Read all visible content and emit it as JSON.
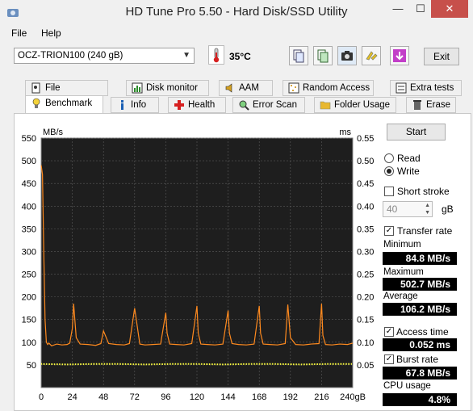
{
  "window": {
    "title": "HD Tune Pro 5.50 - Hard Disk/SSD Utility",
    "minimize": "—",
    "maximize": "☐",
    "close": "✕"
  },
  "menu": [
    {
      "label": "File"
    },
    {
      "label": "Help"
    }
  ],
  "toolbar": {
    "drive": "OCZ-TRION100 (240 gB)",
    "temperature": "35°C",
    "exit_label": "Exit",
    "buttons": [
      "copy-text-icon",
      "copy-info-icon",
      "screenshot-icon",
      "options-icon",
      "save-icon"
    ]
  },
  "tabs_row1": [
    {
      "label": "File Benchmark",
      "icon": "file-benchmark-icon"
    },
    {
      "label": "Disk monitor",
      "icon": "disk-monitor-icon"
    },
    {
      "label": "AAM",
      "icon": "speaker-icon"
    },
    {
      "label": "Random Access",
      "icon": "random-access-icon"
    },
    {
      "label": "Extra tests",
      "icon": "extra-tests-icon"
    }
  ],
  "tabs_row2": [
    {
      "label": "Benchmark",
      "icon": "benchmark-icon",
      "active": true
    },
    {
      "label": "Info",
      "icon": "info-icon"
    },
    {
      "label": "Health",
      "icon": "health-icon"
    },
    {
      "label": "Error Scan",
      "icon": "error-scan-icon"
    },
    {
      "label": "Folder Usage",
      "icon": "folder-icon"
    },
    {
      "label": "Erase",
      "icon": "trash-icon"
    }
  ],
  "controls": {
    "start_label": "Start",
    "read_label": "Read",
    "write_label": "Write",
    "mode": "write",
    "short_stroke_label": "Short stroke",
    "short_stroke_checked": false,
    "short_stroke_value": "40",
    "short_stroke_unit": "gB",
    "transfer_rate_label": "Transfer rate",
    "transfer_rate_checked": true,
    "minimum_label": "Minimum",
    "minimum_value": "84.8 MB/s",
    "maximum_label": "Maximum",
    "maximum_value": "502.7 MB/s",
    "average_label": "Average",
    "average_value": "106.2 MB/s",
    "access_time_label": "Access time",
    "access_time_checked": true,
    "access_time_value": "0.052 ms",
    "burst_rate_label": "Burst rate",
    "burst_rate_checked": true,
    "burst_rate_value": "67.8 MB/s",
    "cpu_usage_label": "CPU usage",
    "cpu_usage_value": "4.8%"
  },
  "colors": {
    "chart_bg": "#1e1e1e",
    "grid": "#5a5a5a",
    "transfer": "#ff8a1e",
    "access": "#ffff40",
    "stat_bg": "#000000",
    "stat_fg": "#ffffff"
  },
  "chart_data": {
    "type": "line",
    "y_left_label": "MB/s",
    "y_right_label": "ms",
    "y_left_ticks": [
      "550",
      "500",
      "450",
      "400",
      "350",
      "300",
      "250",
      "200",
      "150",
      "100",
      "50"
    ],
    "y_right_ticks": [
      "0.55",
      "0.50",
      "0.45",
      "0.40",
      "0.35",
      "0.30",
      "0.25",
      "0.20",
      "0.15",
      "0.10",
      "0.05"
    ],
    "x_ticks": [
      "0",
      "24",
      "48",
      "72",
      "96",
      "120",
      "144",
      "168",
      "192",
      "216",
      "240gB"
    ],
    "ylim_left": [
      0,
      550
    ],
    "ylim_right": [
      0,
      0.55
    ],
    "xlim": [
      0,
      240
    ],
    "grid": true,
    "series": [
      {
        "name": "Transfer rate",
        "axis": "left",
        "x": [
          0,
          1,
          2,
          3,
          4,
          5,
          6,
          8,
          12,
          16,
          20,
          22,
          24,
          25,
          27,
          30,
          36,
          42,
          46,
          48,
          52,
          58,
          64,
          68,
          72,
          76,
          80,
          86,
          92,
          96,
          97,
          99,
          104,
          110,
          116,
          120,
          121,
          123,
          128,
          134,
          140,
          144,
          145,
          147,
          152,
          158,
          164,
          168,
          169,
          171,
          176,
          182,
          188,
          190,
          192,
          196,
          202,
          208,
          214,
          216,
          217,
          219,
          224,
          230,
          236,
          240
        ],
        "y": [
          490,
          470,
          300,
          150,
          100,
          95,
          98,
          92,
          96,
          94,
          95,
          98,
          130,
          185,
          110,
          96,
          95,
          93,
          97,
          125,
          97,
          95,
          94,
          97,
          175,
          96,
          94,
          95,
          96,
          165,
          120,
          96,
          95,
          94,
          97,
          180,
          120,
          96,
          95,
          94,
          96,
          170,
          120,
          97,
          95,
          94,
          96,
          180,
          120,
          96,
          95,
          94,
          97,
          183,
          110,
          95,
          94,
          96,
          97,
          185,
          115,
          95,
          94,
          96,
          95,
          98
        ]
      },
      {
        "name": "Access time",
        "axis": "right",
        "x": [
          0,
          20,
          40,
          60,
          80,
          100,
          120,
          140,
          160,
          180,
          200,
          220,
          240
        ],
        "y": [
          0.052,
          0.051,
          0.052,
          0.052,
          0.051,
          0.052,
          0.052,
          0.051,
          0.052,
          0.052,
          0.051,
          0.052,
          0.052
        ]
      }
    ]
  }
}
